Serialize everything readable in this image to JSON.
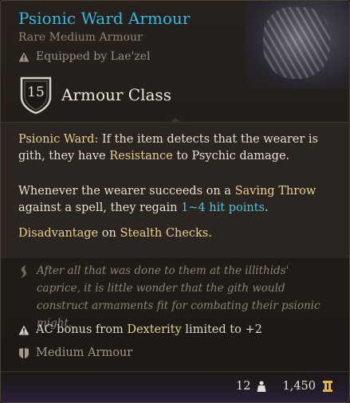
{
  "item": {
    "name": "Psionic Ward Armour",
    "type": "Rare Medium Armour",
    "equipped": "Equipped by Lae'zel"
  },
  "armour_class": {
    "value": "15",
    "label": "Armour Class"
  },
  "description": {
    "p1": {
      "label": "Psionic Ward:",
      "t1": " If the item detects that the wearer is gith, they have ",
      "resistance": "Resistance",
      "t2": " to Psychic damage."
    },
    "p2": {
      "t1": "Whenever the wearer succeeds on a ",
      "saving_throw": "Saving Throw",
      "t2": " against a spell, they regain ",
      "hp": "1~4 hit points",
      "t3": "."
    },
    "p3": {
      "disadvantage": "Disadvantage",
      "t1": " on ",
      "stealth": "Stealth Checks",
      "t2": "."
    }
  },
  "lore": "After all that was done to them at the illithids' caprice, it is little wonder that the gith would construct armaments fit for combating their psionic might.",
  "notes": {
    "ac_bonus": {
      "t1": "AC bonus from ",
      "dexterity": "Dexterity",
      "t2": " limited to +2"
    },
    "proficiency": "Medium Armour"
  },
  "footer": {
    "weight": "12",
    "price": "1,450"
  },
  "colors": {
    "title": "#35b8e3",
    "highlight": "#e8d090",
    "heal": "#4fc3d6"
  },
  "icons": [
    "warning-icon",
    "shield-icon",
    "lore-quill-icon",
    "armour-icon",
    "weight-icon",
    "gold-icon"
  ]
}
